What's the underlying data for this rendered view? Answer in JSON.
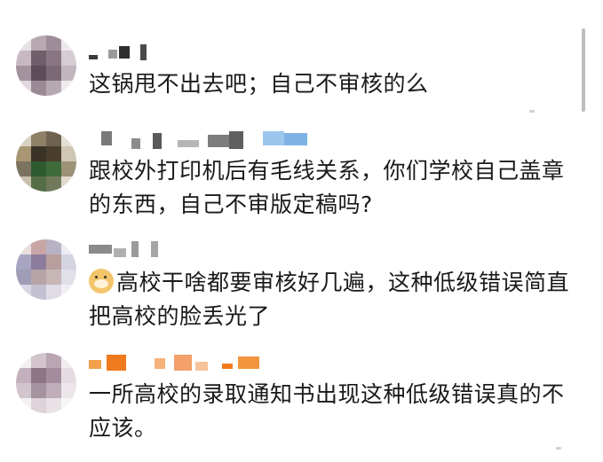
{
  "comments": [
    {
      "text": "这锅甩不出去吧；自己不审核的么"
    },
    {
      "text": "跟校外打印机后有毛线关系，你们学校自己盖章的东西，自己不审版定稿吗?"
    },
    {
      "text": "高校干啥都要审核好几遍，这种低级错误简直把高校的脸丢光了"
    },
    {
      "text": "一所高校的录取通知书出现这种低级错误真的不应该。"
    }
  ]
}
